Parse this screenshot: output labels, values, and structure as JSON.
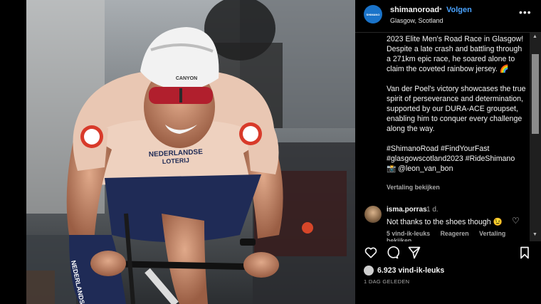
{
  "post": {
    "username": "shimanoroad",
    "separator": "•",
    "follow_label": "Volgen",
    "location": "Glasgow, Scotland",
    "more_label": "•••",
    "avatar_text": "SHIMANO",
    "caption": [
      "2023 Elite Men's Road Race in Glasgow! Despite a late crash and battling through a 271km epic race, he soared alone to claim the coveted rainbow jersey. 🌈",
      "Van der Poel's victory showcases the true spirit of perseverance and determination, supported by our DURA-ACE groupset, enabling him to conquer every challenge along the way.",
      "#ShimanoRoad #FindYourFast #glasgowscotland2023 #RideShimano 📸 @leon_van_bon"
    ],
    "see_translation": "Vertaling bekijken",
    "likes": "6.923 vind-ik-leuks",
    "date": "1 DAG GELEDEN"
  },
  "comment": {
    "username": "isma.porras",
    "time": "1 d.",
    "text": "Not thanks to the shoes though 😉",
    "likes_label": "5 vind-ik-leuks",
    "reply_label": "Reageren",
    "translate_label": "Vertaling bekijken"
  },
  "photo": {
    "helmet_brand": "CANYON",
    "jersey_line1": "NEDERLANDSE",
    "jersey_line2": "LOTERIJ",
    "shorts_text": "NEDERLANDSE",
    "next_arrow": "›"
  },
  "icons": {
    "like": "heart-icon",
    "comment": "comment-icon",
    "share": "send-icon",
    "save": "bookmark-icon"
  },
  "colors": {
    "follow": "#4aa3ff",
    "background": "#000000",
    "secondary_text": "#a8a8a8"
  }
}
